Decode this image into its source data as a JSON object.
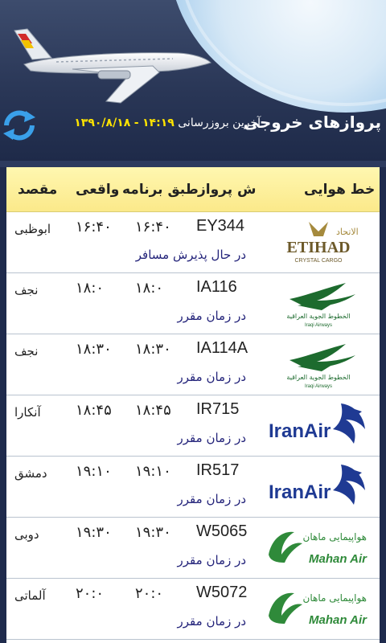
{
  "header": {
    "title": "پروازهای خروجی",
    "last_update_label": "آخرین بروزرسانی",
    "last_update_time": "۱۴:۱۹",
    "last_update_sep": "-",
    "last_update_date": "۱۳۹۰/۸/۱۸"
  },
  "table": {
    "columns": {
      "airline": "خط هوایی",
      "flight": "ش پرواز",
      "scheduled": "طبق برنامه",
      "actual": "واقعی",
      "destination": "مقصد"
    },
    "rows": [
      {
        "flight": "EY344",
        "scheduled": "۱۶:۴۰",
        "actual": "۱۶:۴۰",
        "destination": "ابوظبی",
        "status": "در حال پذیرش مسافر",
        "airline_logo": "etihad-logo",
        "airline_name": "ETIHAD",
        "airline_sub": "CRYSTAL CARGO",
        "airline_native": "الاتحاد"
      },
      {
        "flight": "IA116",
        "scheduled": "۱۸:۰",
        "actual": "۱۸:۰",
        "destination": "نجف",
        "status": "در زمان مقرر",
        "airline_logo": "iraqi-airways-logo",
        "airline_native": "الخطوط الجوية العراقية",
        "airline_name": "Iraqi Airways"
      },
      {
        "flight": "IA114A",
        "scheduled": "۱۸:۳۰",
        "actual": "۱۸:۳۰",
        "destination": "نجف",
        "status": "در زمان مقرر",
        "airline_logo": "iraqi-airways-logo",
        "airline_native": "الخطوط الجوية العراقية",
        "airline_name": "Iraqi Airways"
      },
      {
        "flight": "IR715",
        "scheduled": "۱۸:۴۵",
        "actual": "۱۸:۴۵",
        "destination": "آنکارا",
        "status": "در زمان مقرر",
        "airline_logo": "iran-air-logo",
        "airline_name": "IranAir"
      },
      {
        "flight": "IR517",
        "scheduled": "۱۹:۱۰",
        "actual": "۱۹:۱۰",
        "destination": "دمشق",
        "status": "در زمان مقرر",
        "airline_logo": "iran-air-logo",
        "airline_name": "IranAir"
      },
      {
        "flight": "W5065",
        "scheduled": "۱۹:۳۰",
        "actual": "۱۹:۳۰",
        "destination": "دوبی",
        "status": "در زمان مقرر",
        "airline_logo": "mahan-air-logo",
        "airline_native": "هواپیمایی ماهان",
        "airline_name": "Mahan Air"
      },
      {
        "flight": "W5072",
        "scheduled": "۲۰:۰",
        "actual": "۲۰:۰",
        "destination": "آلماتی",
        "status": "در زمان مقرر",
        "airline_logo": "mahan-air-logo",
        "airline_native": "هواپیمایی ماهان",
        "airline_name": "Mahan Air"
      }
    ]
  },
  "colors": {
    "header_bg": "#2a3757",
    "table_header_bg": "#fbe98a",
    "status_text": "#23237a",
    "update_time": "#ffe400",
    "iran_air_blue": "#1f3a93",
    "mahan_green": "#2f8a3a",
    "iraqi_green": "#1d6b2e",
    "etihad_gold": "#a58a3d"
  }
}
